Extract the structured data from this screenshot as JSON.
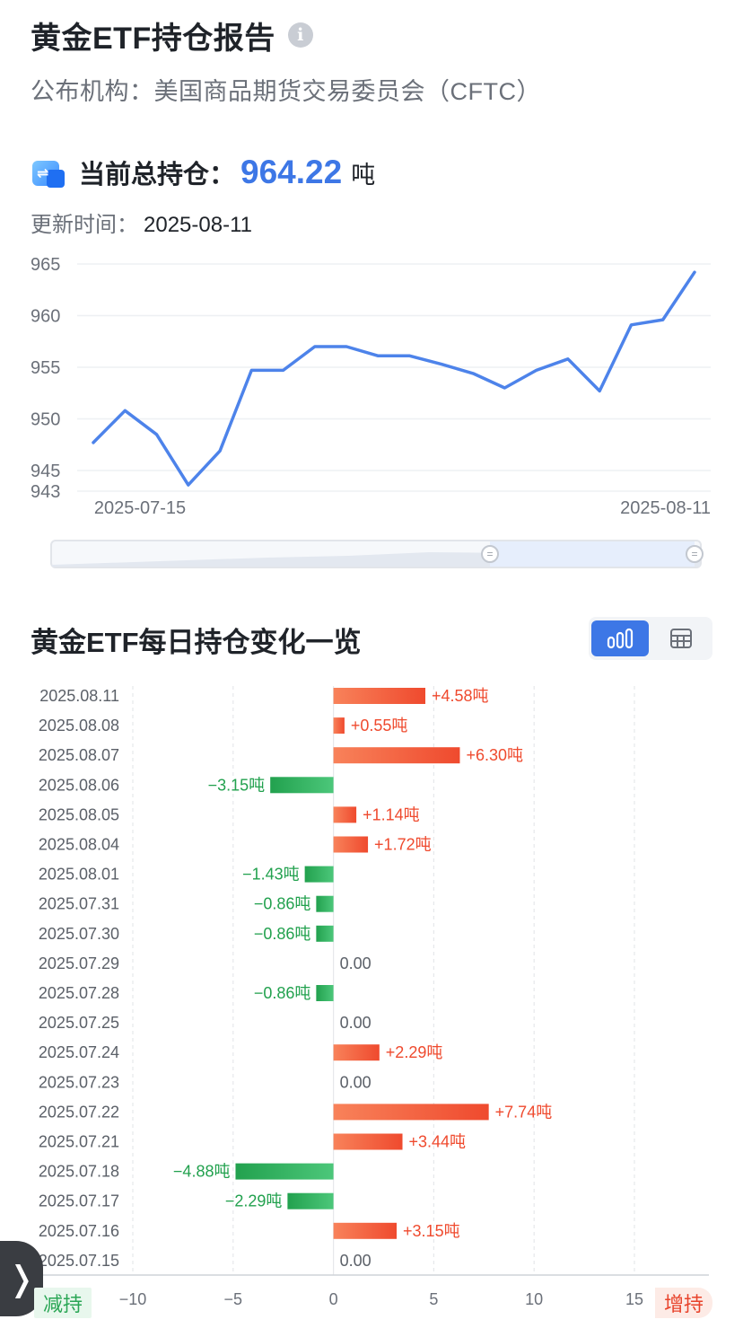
{
  "header": {
    "title": "黄金ETF持仓报告",
    "info_icon": "info-circle-icon",
    "publisher": "公布机构：美国商品期货交易委员会（CFTC）"
  },
  "summary": {
    "label": "当前总持仓：",
    "value": "964.22",
    "unit": "吨",
    "update_label": "更新时间：",
    "update_date": "2025-08-11",
    "icon": "transfer-icon"
  },
  "section": {
    "title": "黄金ETF每日持仓变化一览",
    "chart_view_icon": "bar-chart-icon",
    "table_view_icon": "table-icon"
  },
  "legend": {
    "decrease": "减持",
    "increase": "增持"
  },
  "colors": {
    "line": "#4d83ea",
    "increase": "#ef4a2e",
    "decrease": "#22a14e",
    "accent": "#3d77e6"
  },
  "chart_data": [
    {
      "type": "line",
      "x": [
        "2025-07-15",
        "2025-07-16",
        "2025-07-17",
        "2025-07-18",
        "2025-07-21",
        "2025-07-22",
        "2025-07-23",
        "2025-07-24",
        "2025-07-25",
        "2025-07-28",
        "2025-07-29",
        "2025-07-30",
        "2025-07-31",
        "2025-08-01",
        "2025-08-04",
        "2025-08-05",
        "2025-08-06",
        "2025-08-07",
        "2025-08-08",
        "2025-08-11"
      ],
      "values": [
        947.7,
        950.8,
        948.5,
        943.6,
        946.9,
        954.7,
        954.7,
        957.0,
        957.0,
        956.1,
        956.1,
        955.3,
        954.4,
        953.0,
        954.7,
        955.8,
        952.7,
        959.1,
        959.6,
        964.2
      ],
      "x_tick_labels": [
        "2025-07-15",
        "2025-08-11"
      ],
      "y_ticks": [
        943,
        945,
        950,
        955,
        960,
        965
      ],
      "ylim": [
        943,
        965
      ],
      "grid": true,
      "has_range_slider": true
    },
    {
      "type": "bar",
      "orientation": "horizontal",
      "categories": [
        "2025.08.11",
        "2025.08.08",
        "2025.08.07",
        "2025.08.06",
        "2025.08.05",
        "2025.08.04",
        "2025.08.01",
        "2025.07.31",
        "2025.07.30",
        "2025.07.29",
        "2025.07.28",
        "2025.07.25",
        "2025.07.24",
        "2025.07.23",
        "2025.07.22",
        "2025.07.21",
        "2025.07.18",
        "2025.07.17",
        "2025.07.16",
        "2025.07.15"
      ],
      "values": [
        4.58,
        0.55,
        6.3,
        -3.15,
        1.14,
        1.72,
        -1.43,
        -0.86,
        -0.86,
        0,
        -0.86,
        0,
        2.29,
        0,
        7.74,
        3.44,
        -4.88,
        -2.29,
        3.15,
        0
      ],
      "labels": [
        "+4.58吨",
        "+0.55吨",
        "+6.30吨",
        "−3.15吨",
        "+1.14吨",
        "+1.72吨",
        "−1.43吨",
        "−0.86吨",
        "−0.86吨",
        "0.00",
        "−0.86吨",
        "0.00",
        "+2.29吨",
        "0.00",
        "+7.74吨",
        "+3.44吨",
        "−4.88吨",
        "−2.29吨",
        "+3.15吨",
        "0.00"
      ],
      "x_ticks": [
        -10,
        -5,
        0,
        5,
        10,
        15
      ],
      "x_tick_labels": [
        "−10",
        "−5",
        "0",
        "5",
        "10",
        "15"
      ],
      "xlim": [
        -10,
        15
      ],
      "grid": true
    }
  ]
}
